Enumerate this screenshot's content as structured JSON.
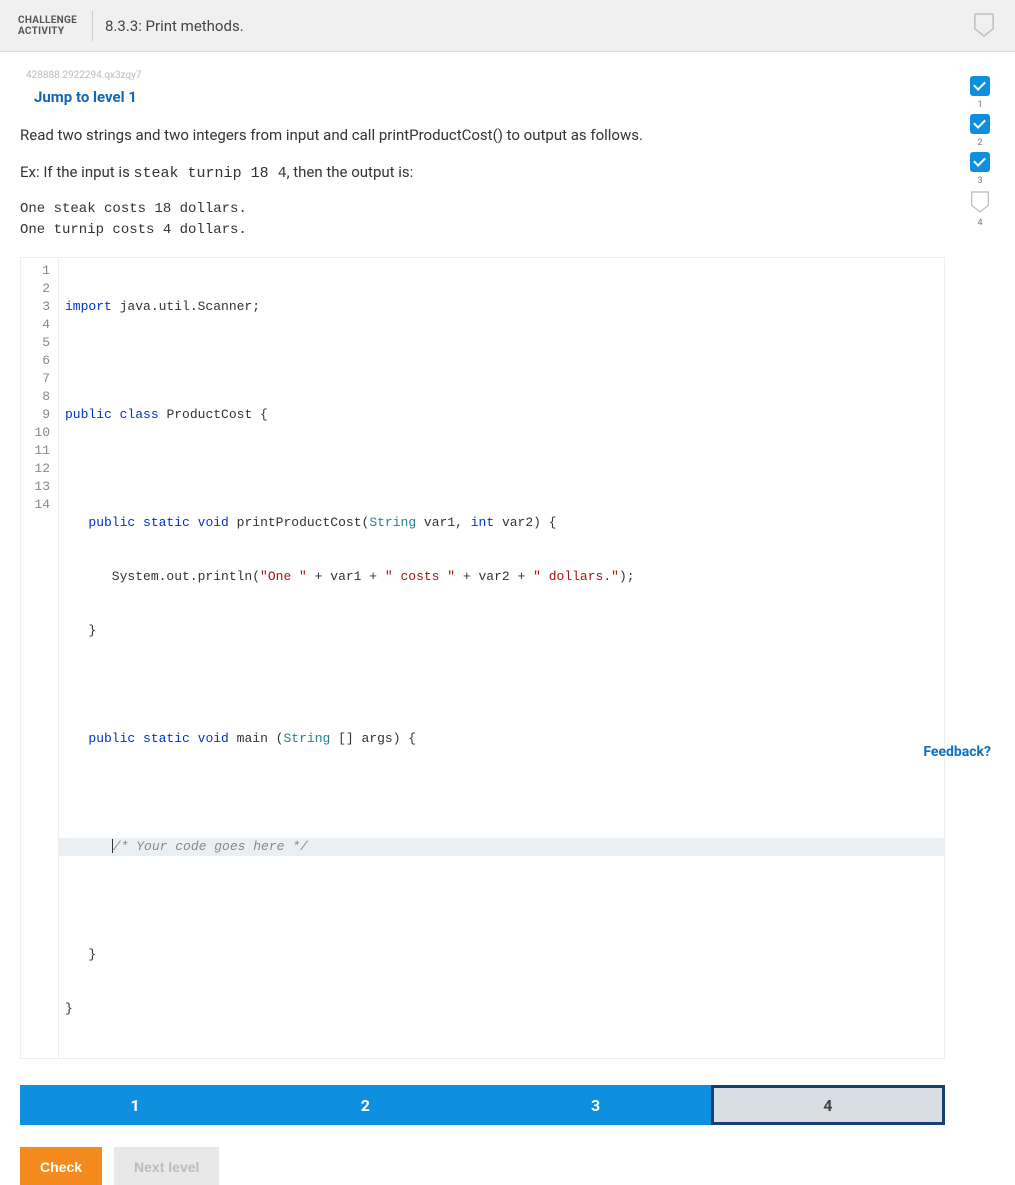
{
  "header": {
    "challenge_label_line1": "CHALLENGE",
    "challenge_label_line2": "ACTIVITY",
    "title": "8.3.3: Print methods."
  },
  "hash": "428888.2922294.qx3zqy7",
  "jump_link": "Jump to level 1",
  "prompt_line1": "Read two strings and two integers from input and call printProductCost() to output as follows.",
  "prompt_line2_pre": "Ex: If the input is ",
  "prompt_line2_code": "steak turnip 18 4",
  "prompt_line2_post": ", then the output is:",
  "output_sample": "One steak costs 18 dollars.\nOne turnip costs 4 dollars.",
  "code": {
    "lines": 14,
    "l1_kw": "import",
    "l1_rest": " java.util.Scanner;",
    "l3_kw1": "public",
    "l3_kw2": "class",
    "l3_name": " ProductCost {",
    "l5_pre": "   ",
    "l5_kw1": "public",
    "l5_kw2": "static",
    "l5_kw3": "void",
    "l5_name": " printProductCost(",
    "l5_type1": "String",
    "l5_v1": " var1, ",
    "l5_type2": "int",
    "l5_v2": " var2) {",
    "l6_pre": "      System.out.println(",
    "l6_s1": "\"One \"",
    "l6_p1": " + var1 + ",
    "l6_s2": "\" costs \"",
    "l6_p2": " + var2 + ",
    "l6_s3": "\" dollars.\"",
    "l6_end": ");",
    "l7": "   }",
    "l9_pre": "   ",
    "l9_kw1": "public",
    "l9_kw2": "static",
    "l9_kw3": "void",
    "l9_name": " main (",
    "l9_type": "String",
    "l9_rest": " [] args) {",
    "l11_pre": "      ",
    "l11_comment": "/* Your code goes here */",
    "l13": "   }",
    "l14": "}"
  },
  "levels": [
    "1",
    "2",
    "3",
    "4"
  ],
  "side_steps": [
    "1",
    "2",
    "3",
    "4"
  ],
  "buttons": {
    "check": "Check",
    "next": "Next level"
  },
  "feedback": "Feedback?"
}
